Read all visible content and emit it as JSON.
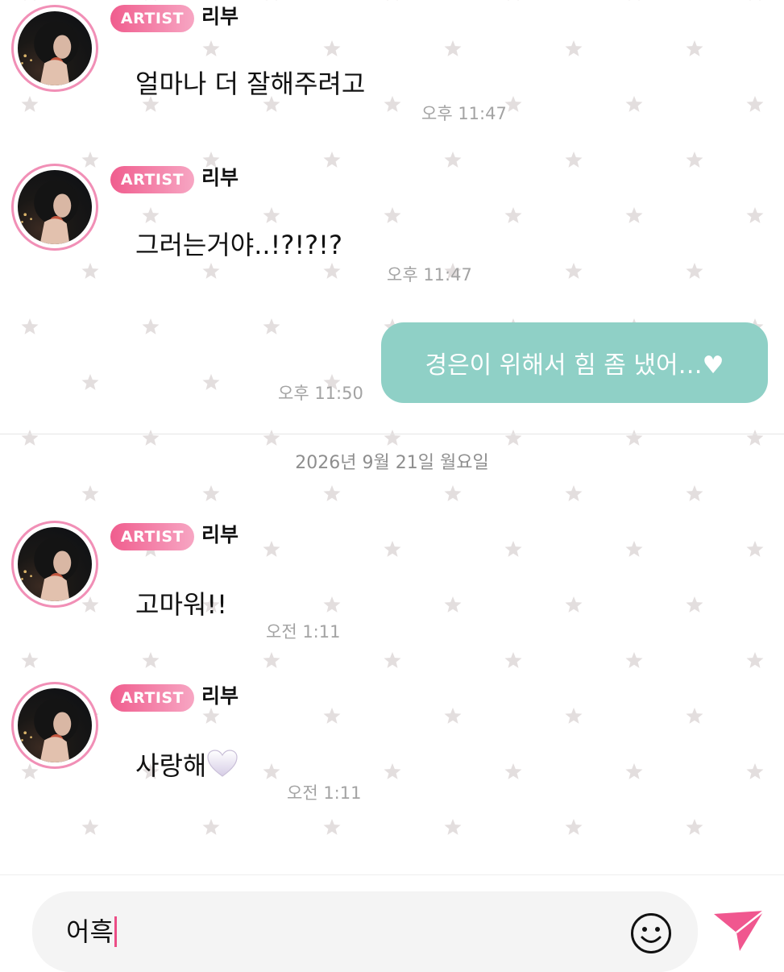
{
  "messages": [
    {
      "badge": "ARTIST",
      "sender": "리부",
      "text": "얼마나 더 잘해주려고",
      "time": "오후 11:47"
    },
    {
      "badge": "ARTIST",
      "sender": "리부",
      "text": "그러는거야..!?!?!?",
      "time": "오후 11:47"
    },
    {
      "text": "경은이 위해서 힘 좀 냈어…♥",
      "time": "오후 11:50"
    },
    {
      "badge": "ARTIST",
      "sender": "리부",
      "text": "고마워!!",
      "time": "오전 1:11"
    },
    {
      "badge": "ARTIST",
      "sender": "리부",
      "text": "사랑해",
      "time": "오전 1:11"
    }
  ],
  "date_divider": "2026년 9월 21일 월요일",
  "composer": {
    "input_value": "어흑"
  },
  "icons": {
    "emoji": "smiley-icon",
    "send": "send-icon",
    "background": "star-pattern"
  },
  "colors": {
    "badge_start": "#f05d8e",
    "badge_end": "#f7a6c3",
    "outgoing_bubble": "#8fd0c6",
    "avatar_ring": "#f18fb6",
    "caret": "#ec4d86",
    "send": "#f0578f",
    "star": "#e3dede"
  }
}
